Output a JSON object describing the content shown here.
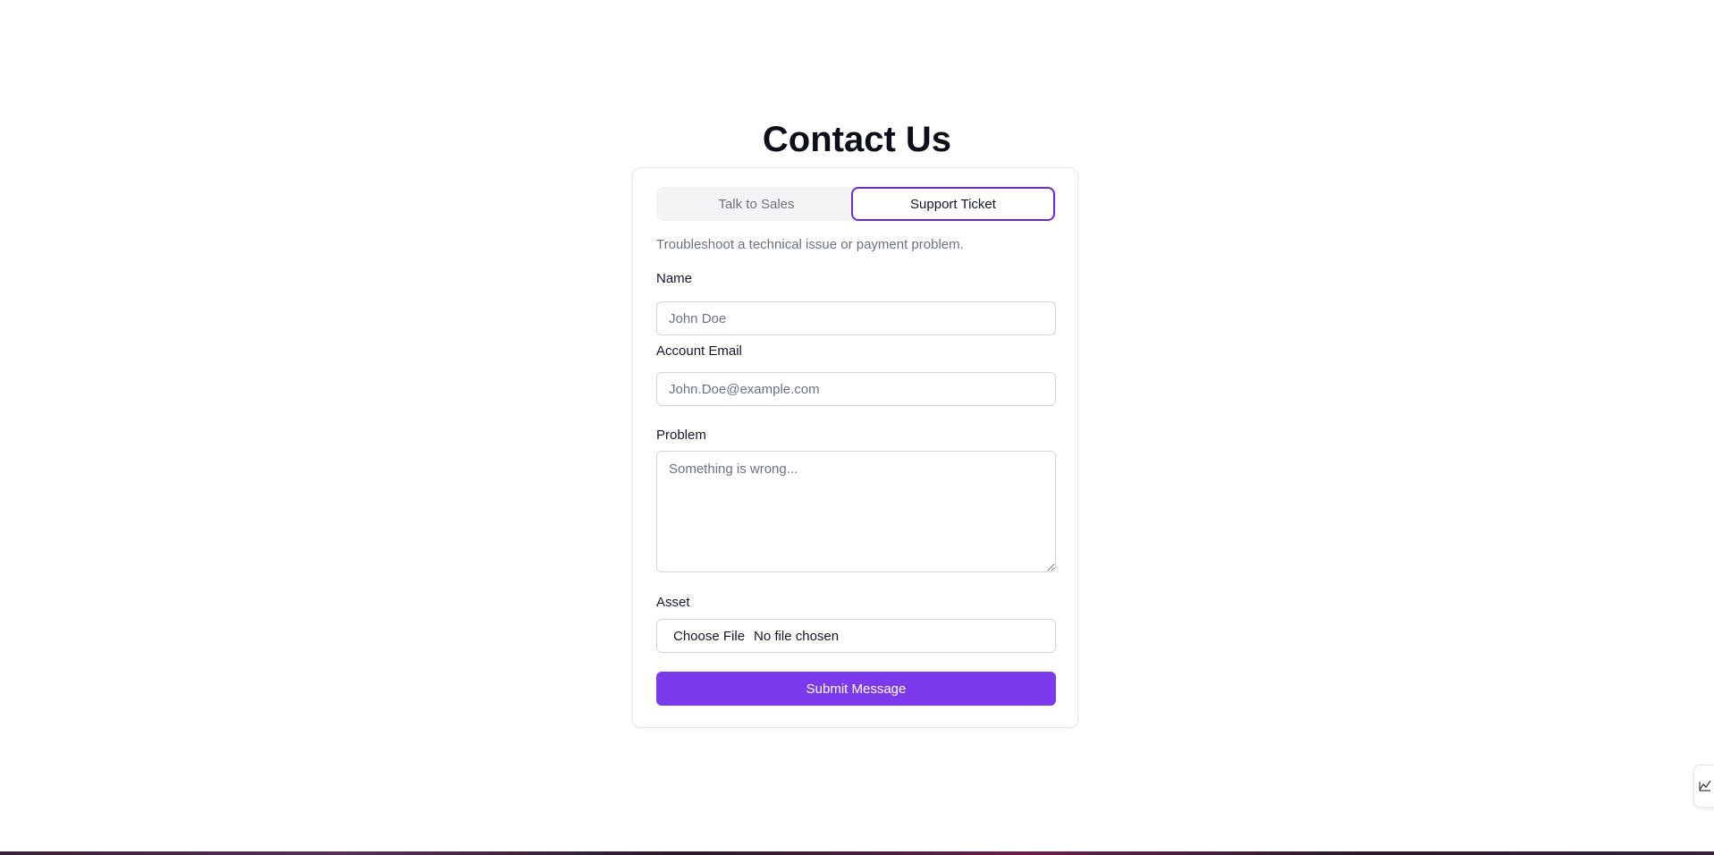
{
  "page": {
    "title": "Contact Us"
  },
  "tabs": [
    {
      "label": "Talk to Sales",
      "active": false
    },
    {
      "label": "Support Ticket",
      "active": true
    }
  ],
  "form": {
    "description": "Troubleshoot a technical issue or payment problem.",
    "name": {
      "label": "Name",
      "placeholder": "John Doe",
      "value": ""
    },
    "email": {
      "label": "Account Email",
      "placeholder": "John.Doe@example.com",
      "value": ""
    },
    "problem": {
      "label": "Problem",
      "placeholder": "Something is wrong...",
      "value": ""
    },
    "asset": {
      "label": "Asset",
      "button_label": "Choose File",
      "status": "No file chosen"
    },
    "submit_label": "Submit Message"
  },
  "colors": {
    "accent": "#7c3aed",
    "active_tab_border": "#6d28d9",
    "muted_text": "#6b7280",
    "tab_background": "#f3f4f6"
  },
  "icons": {
    "side_widget": "chart-line-icon"
  }
}
